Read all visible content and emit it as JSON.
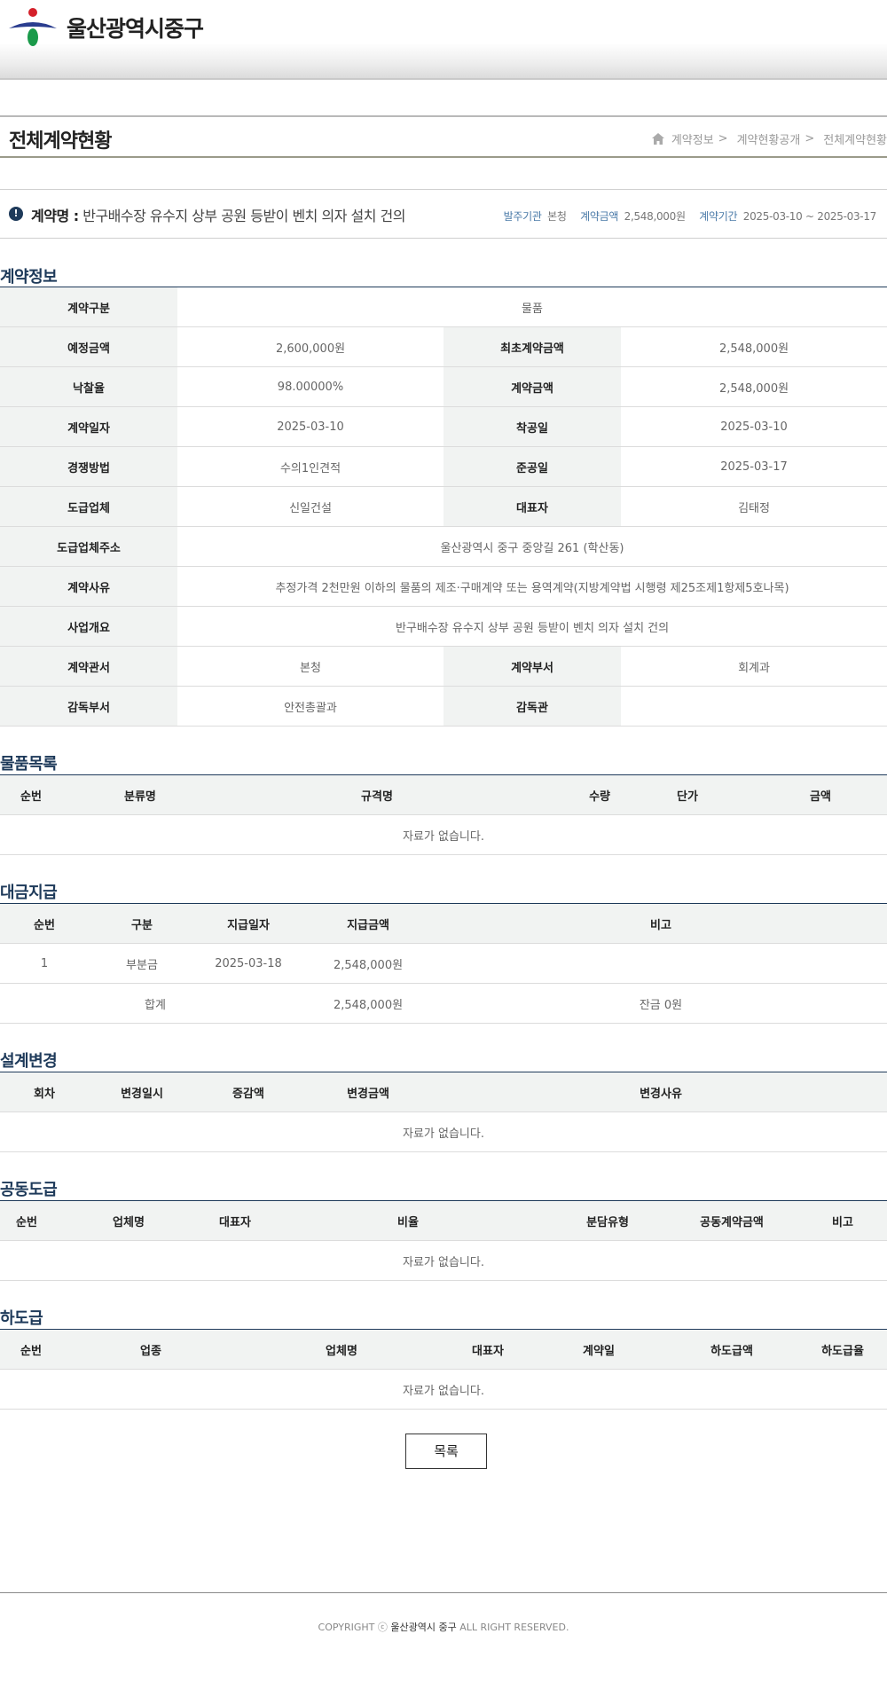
{
  "header": {
    "org_name": "울산광역시중구"
  },
  "page": {
    "title": "전체계약현황",
    "breadcrumb": [
      "계약정보",
      "계약현황공개",
      "전체계약현황"
    ]
  },
  "summary": {
    "prefix": "계약명 :",
    "contract_name": "반구배수장 유수지 상부 공원 등받이 벤치 의자 설치 건의",
    "agency_label": "발주기관",
    "agency_value": "본청",
    "amount_label": "계약금액",
    "amount_value": "2,548,000원",
    "period_label": "계약기간",
    "period_value": "2025-03-10 ~ 2025-03-17"
  },
  "contract_info": {
    "section_title": "계약정보",
    "rows": [
      [
        {
          "label": "계약구분",
          "value": "물품"
        }
      ],
      [
        {
          "label": "예정금액",
          "value": "2,600,000원"
        },
        {
          "label": "최초계약금액",
          "value": "2,548,000원"
        }
      ],
      [
        {
          "label": "낙찰율",
          "value": "98.00000%"
        },
        {
          "label": "계약금액",
          "value": "2,548,000원"
        }
      ],
      [
        {
          "label": "계약일자",
          "value": "2025-03-10"
        },
        {
          "label": "착공일",
          "value": "2025-03-10"
        }
      ],
      [
        {
          "label": "경쟁방법",
          "value": "수의1인견적"
        },
        {
          "label": "준공일",
          "value": "2025-03-17"
        }
      ],
      [
        {
          "label": "도급업체",
          "value": "신일건설"
        },
        {
          "label": "대표자",
          "value": "김태정"
        }
      ],
      [
        {
          "label": "도급업체주소",
          "value": "울산광역시 중구 중앙길 261 (학산동)"
        }
      ],
      [
        {
          "label": "계약사유",
          "value": "추정가격 2천만원 이하의 물품의 제조·구매계약 또는 용역계약(지방계약법 시행령 제25조제1항제5호나목)"
        }
      ],
      [
        {
          "label": "사업개요",
          "value": "반구배수장 유수지 상부 공원 등받이 벤치 의자 설치 건의"
        }
      ],
      [
        {
          "label": "계약관서",
          "value": "본청"
        },
        {
          "label": "계약부서",
          "value": "회계과"
        }
      ],
      [
        {
          "label": "감독부서",
          "value": "안전총괄과"
        },
        {
          "label": "감독관",
          "value": ""
        }
      ]
    ]
  },
  "goods": {
    "section_title": "물품목록",
    "columns": [
      "순번",
      "분류명",
      "규격명",
      "수량",
      "단가",
      "금액"
    ],
    "empty_text": "자료가 없습니다."
  },
  "payment": {
    "section_title": "대금지급",
    "columns": [
      "순번",
      "구분",
      "지급일자",
      "지급금액",
      "비고"
    ],
    "rows": [
      [
        "1",
        "부분금",
        "2025-03-18",
        "2,548,000원",
        ""
      ]
    ],
    "total": {
      "label": "합계",
      "amount": "2,548,000원",
      "note": "잔금 0원"
    }
  },
  "design_change": {
    "section_title": "설계변경",
    "columns": [
      "회차",
      "변경일시",
      "증감액",
      "변경금액",
      "변경사유"
    ],
    "empty_text": "자료가 없습니다."
  },
  "joint": {
    "section_title": "공동도급",
    "columns": [
      "순번",
      "업체명",
      "대표자",
      "비율",
      "분담유형",
      "공동계약금액",
      "비고"
    ],
    "empty_text": "자료가 없습니다."
  },
  "subcontract": {
    "section_title": "하도급",
    "columns": [
      "순번",
      "업종",
      "업체명",
      "대표자",
      "계약일",
      "하도급액",
      "하도급율"
    ],
    "empty_text": "자료가 없습니다."
  },
  "buttons": {
    "list_label": "목록"
  },
  "footer": {
    "copyright_prefix": "COPYRIGHT ⓒ",
    "copyright_org": "울산광역시 중구",
    "copyright_suffix": "ALL RIGHT RESERVED."
  },
  "colors": {
    "primary": "#1e3a5a",
    "header_bg": "#f1f3f2",
    "link_label": "#4a7aa8"
  }
}
